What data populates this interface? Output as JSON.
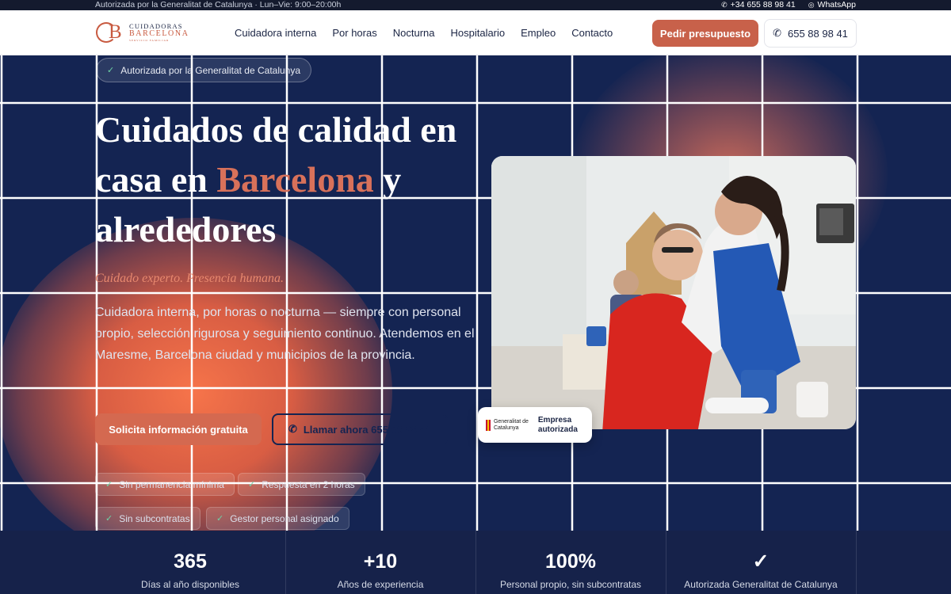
{
  "topbar": {
    "info": "Autorizada por la Generalitat de Catalunya · Lun–Vie: 9:00–20:00h",
    "phone": "+34 655 88 98 41",
    "whatsapp": "WhatsApp"
  },
  "nav": {
    "logo_line1": "CUIDADORAS",
    "logo_line2": "BARCELONA",
    "logo_line3": "SERVICIO FAMILIAR",
    "items": [
      {
        "label": "Cuidadora interna"
      },
      {
        "label": "Por horas"
      },
      {
        "label": "Nocturna"
      },
      {
        "label": "Hospitalario"
      },
      {
        "label": "Empleo"
      },
      {
        "label": "Contacto"
      }
    ],
    "cta_label": "Pedir presupuesto",
    "phone_label": "655 88 98 41"
  },
  "hero": {
    "badge": "Autorizada por la Generalitat de Catalunya",
    "title_part1": "Cuidados de calidad en casa en ",
    "title_highlight": "Barcelona",
    "title_part2": " y alrededores",
    "tagline": "Cuidado experto. Presencia humana.",
    "description": "Cuidadora interna, por horas o nocturna — siempre con personal propio, selección rigurosa y seguimiento continuo. Atendemos en el Maresme, Barcelona ciudad y municipios de la provincia.",
    "primary_button": "Solicita información gratuita",
    "secondary_button": "Llamar ahora 655 88 98 41",
    "chips": [
      {
        "label": "Sin permanencia mínima"
      },
      {
        "label": "Respuesta en 2 horas"
      },
      {
        "label": "Sin subcontratas"
      },
      {
        "label": "Gestor personal asignado"
      }
    ],
    "gen_badge_logo": "Generalitat de Catalunya",
    "gen_badge_text": "Empresa autorizada"
  },
  "stats": [
    {
      "value": "365",
      "label": "Días al año disponibles"
    },
    {
      "value": "+10",
      "label": "Años de experiencia"
    },
    {
      "value": "100%",
      "label": "Personal propio, sin subcontratas"
    },
    {
      "value": "✓",
      "label": "Autorizada Generalitat de Catalunya"
    }
  ],
  "colors": {
    "accent": "#c8614a",
    "navy": "#142452",
    "highlight": "#d8715a"
  }
}
